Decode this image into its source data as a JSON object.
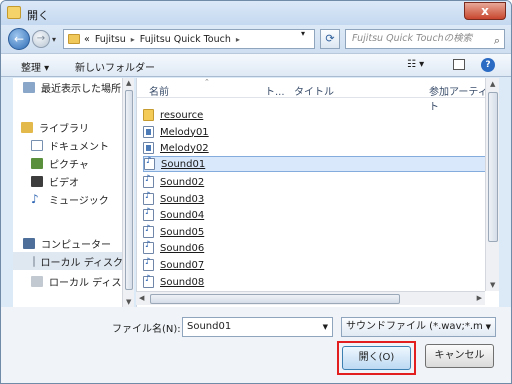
{
  "window": {
    "title": "開く",
    "close_glyph": "x"
  },
  "nav": {
    "breadcrumb": [
      {
        "label": "«"
      },
      {
        "label": "Fujitsu"
      },
      {
        "label": "Fujitsu Quick Touch"
      }
    ],
    "search_placeholder": "Fujitsu Quick Touchの検索"
  },
  "toolbar": {
    "organize": "整理 ▾",
    "new_folder": "新しいフォルダー",
    "views_glyph": "☷ ▾",
    "help": "?"
  },
  "sidebar": {
    "items": [
      {
        "label": "最近表示した場所",
        "icon": "recent-places-icon"
      },
      {
        "label": "ライブラリ",
        "icon": "library-icon"
      },
      {
        "label": "ドキュメント",
        "icon": "documents-icon"
      },
      {
        "label": "ピクチャ",
        "icon": "pictures-icon"
      },
      {
        "label": "ビデオ",
        "icon": "videos-icon"
      },
      {
        "label": "ミュージック",
        "icon": "music-icon"
      },
      {
        "label": "コンピューター",
        "icon": "computer-icon"
      },
      {
        "label": "ローカル ディスク",
        "icon": "local-disk-icon"
      },
      {
        "label": "ローカル ディスク",
        "icon": "local-disk-icon"
      }
    ]
  },
  "columns": {
    "name": "名前",
    "track": "ト...",
    "title": "タイトル",
    "artist": "参加アーティスト"
  },
  "files": [
    {
      "name": "resource",
      "type": "folder"
    },
    {
      "name": "Melody01",
      "type": "midi"
    },
    {
      "name": "Melody02",
      "type": "midi"
    },
    {
      "name": "Sound01",
      "type": "wav",
      "selected": true
    },
    {
      "name": "Sound02",
      "type": "wav"
    },
    {
      "name": "Sound03",
      "type": "wav"
    },
    {
      "name": "Sound04",
      "type": "wav"
    },
    {
      "name": "Sound05",
      "type": "wav"
    },
    {
      "name": "Sound06",
      "type": "wav"
    },
    {
      "name": "Sound07",
      "type": "wav"
    },
    {
      "name": "Sound08",
      "type": "wav"
    }
  ],
  "footer": {
    "filename_label": "ファイル名(N):",
    "filename_value": "Sound01",
    "filetype_value": "サウンドファイル (*.wav;*.m",
    "open_label": "開く(O)",
    "cancel_label": "キャンセル"
  }
}
